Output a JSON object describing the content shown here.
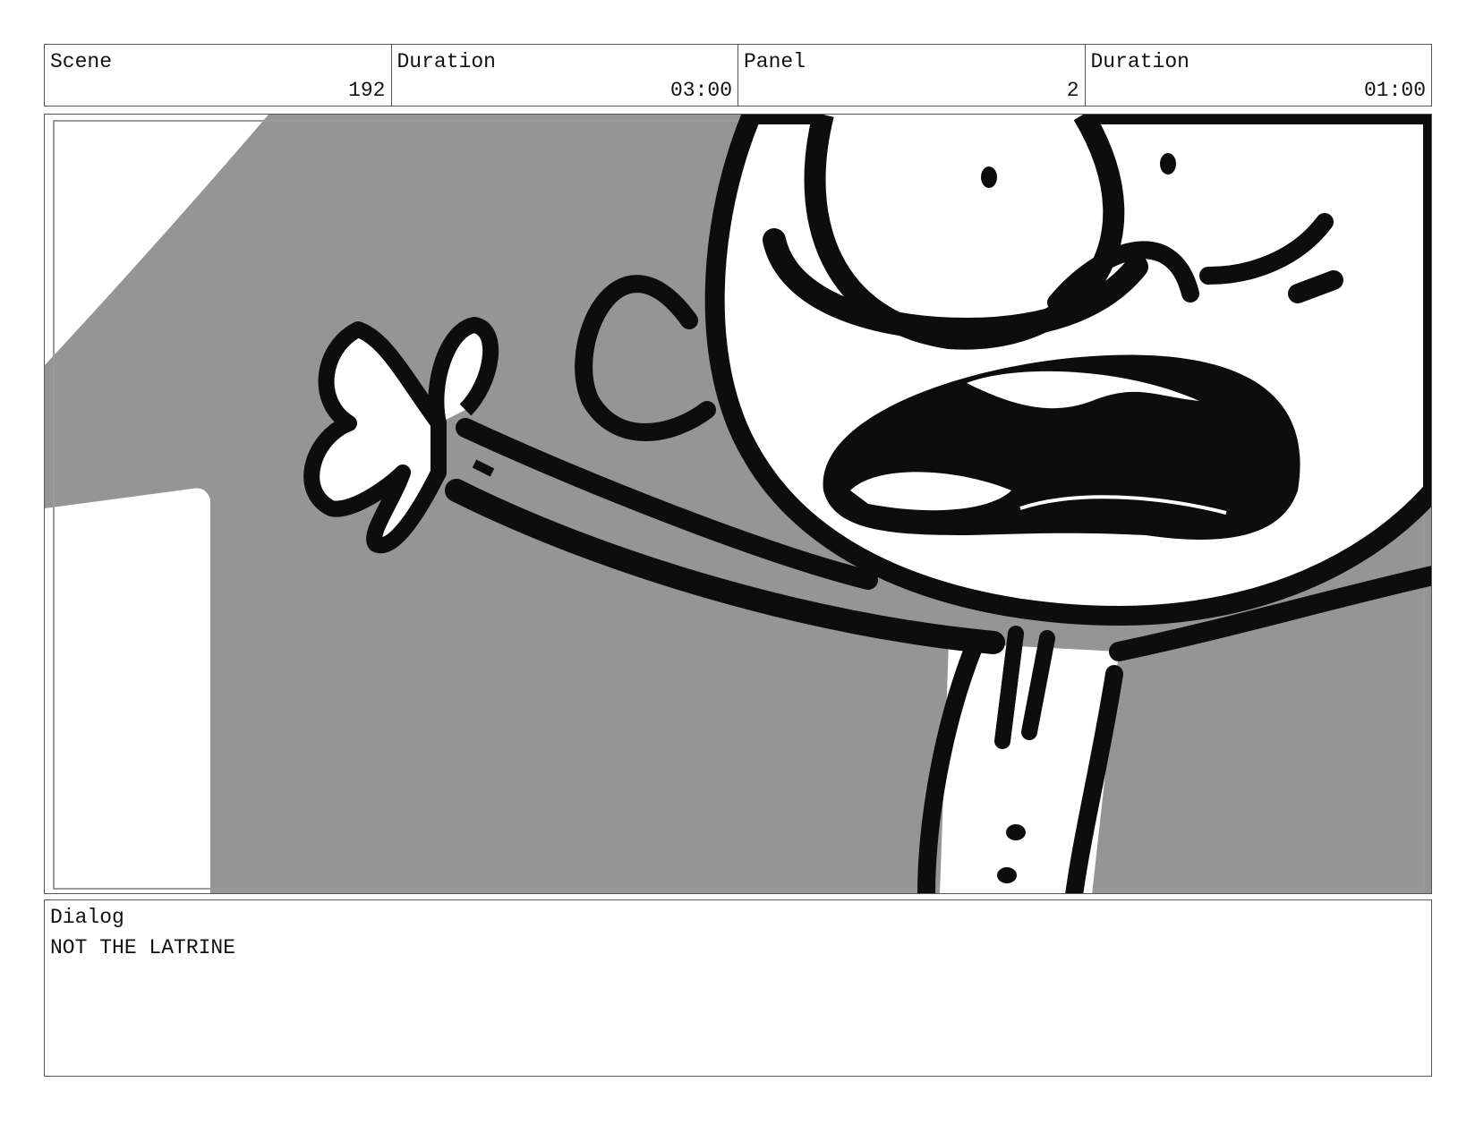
{
  "header": {
    "scene": {
      "label": "Scene",
      "value": "192"
    },
    "scene_duration": {
      "label": "Duration",
      "value": "03:00"
    },
    "panel": {
      "label": "Panel",
      "value": "2"
    },
    "panel_duration": {
      "label": "Duration",
      "value": "01:00"
    }
  },
  "dialog": {
    "label": "Dialog",
    "text": "NOT THE LATRINE"
  },
  "colors": {
    "background_gray": "#959595",
    "ink": "#0d0d0d",
    "paper": "#ffffff"
  }
}
